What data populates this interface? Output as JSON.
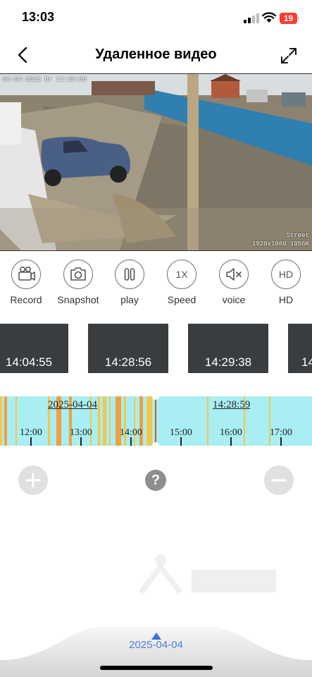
{
  "status_bar": {
    "time": "13:03",
    "battery": "19"
  },
  "header": {
    "title": "Удаленное видео",
    "back_icon": "chevron-left-icon",
    "fullscreen_icon": "expand-arrows-icon"
  },
  "video": {
    "osd_datetime": "04-04-2025 Пт 14:28:00",
    "osd_camera": "Street",
    "osd_resolution": "1920x1080 1056K"
  },
  "controls": [
    {
      "label": "Record",
      "icon": "video-camera-icon"
    },
    {
      "label": "Snapshot",
      "icon": "camera-icon"
    },
    {
      "label": "play",
      "icon": "pause-icon"
    },
    {
      "label": "Speed",
      "icon_text": "1X"
    },
    {
      "label": "voice",
      "icon": "speaker-muted-icon"
    },
    {
      "label": "HD",
      "icon_text": "HD"
    }
  ],
  "thumbnails": [
    {
      "time": "14:04:55"
    },
    {
      "time": "14:28:56"
    },
    {
      "time": "14:29:38"
    },
    {
      "time": "14:"
    }
  ],
  "timeline": {
    "date": "2025-04-04",
    "cursor_time": "14:28:59",
    "hour_labels": [
      "12:00",
      "13:00",
      "14:00",
      "15:00",
      "16:00",
      "17:00"
    ],
    "colors": {
      "background": "#a8eef2",
      "recording": "#f5c64a",
      "motion": "#f0a040",
      "cursor": "#e0531d"
    }
  },
  "bottom": {
    "date": "2025-04-04"
  },
  "colors": {
    "accent": "#4a7de0",
    "control_stroke": "#6c6c6c",
    "battery": "#ff3b30"
  }
}
